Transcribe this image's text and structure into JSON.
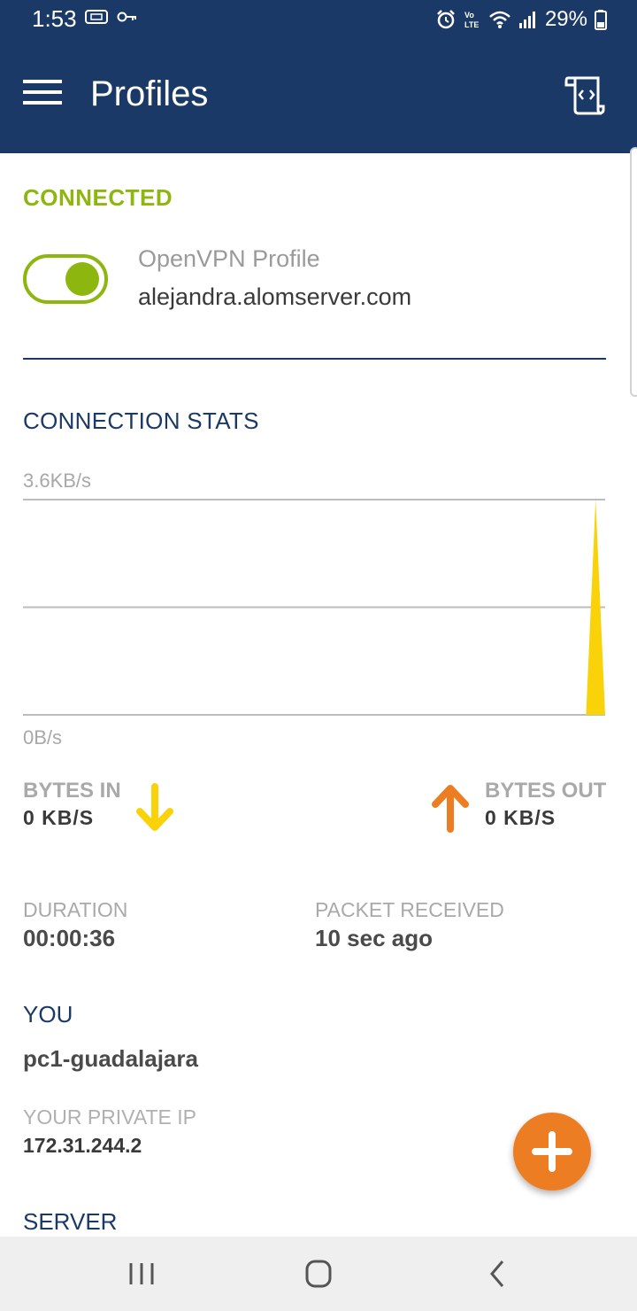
{
  "status_bar": {
    "time": "1:53",
    "battery": "29%",
    "icons": [
      "vpn-key-icon",
      "alarm-icon",
      "volte-icon",
      "wifi-icon",
      "signal-icon",
      "battery-icon"
    ]
  },
  "app_bar": {
    "title": "Profiles",
    "menu_icon": "hamburger-menu-icon",
    "log_icon": "log-file-icon"
  },
  "connection": {
    "status": "CONNECTED",
    "profile_type": "OpenVPN Profile",
    "host": "alejandra.alomserver.com",
    "enabled": true
  },
  "stats": {
    "heading": "CONNECTION STATS",
    "chart_max_label": "3.6KB/s",
    "chart_min_label": "0B/s",
    "bytes_in_label": "BYTES IN",
    "bytes_in_value": "0 KB/S",
    "bytes_out_label": "BYTES OUT",
    "bytes_out_value": "0 KB/S",
    "duration_label": "DURATION",
    "duration_value": "00:00:36",
    "packet_label": "PACKET RECEIVED",
    "packet_value": "10 sec ago"
  },
  "chart_data": {
    "type": "area",
    "ylim": [
      0,
      3.6
    ],
    "y_unit": "KB/s",
    "gridlines": [
      3.6,
      1.8,
      0
    ],
    "series": [
      {
        "values": [
          0,
          0,
          0,
          0,
          0,
          0,
          0,
          0,
          0,
          0,
          0,
          0,
          0,
          0,
          0,
          0,
          0,
          0,
          0,
          0,
          0,
          0,
          0,
          0,
          0,
          0,
          0,
          0,
          0,
          0,
          0,
          0,
          0,
          0,
          0,
          0,
          0,
          0,
          0,
          0,
          0,
          0,
          0,
          0,
          0,
          0,
          0,
          0,
          0,
          0,
          0,
          0,
          0,
          0,
          0,
          0,
          0,
          0,
          0,
          0,
          3.6,
          0
        ],
        "color": "#f9d20a"
      }
    ]
  },
  "you": {
    "heading": "YOU",
    "name": "pc1-guadalajara",
    "private_ip_label": "YOUR PRIVATE IP",
    "private_ip": "172.31.244.2"
  },
  "server": {
    "heading": "SERVER"
  },
  "fab": {
    "icon": "plus-icon"
  },
  "colors": {
    "primary": "#1a3966",
    "connected": "#8db60f",
    "bytes_in": "#f9d20a",
    "bytes_out": "#ed7d23",
    "fab": "#ed7d23"
  }
}
